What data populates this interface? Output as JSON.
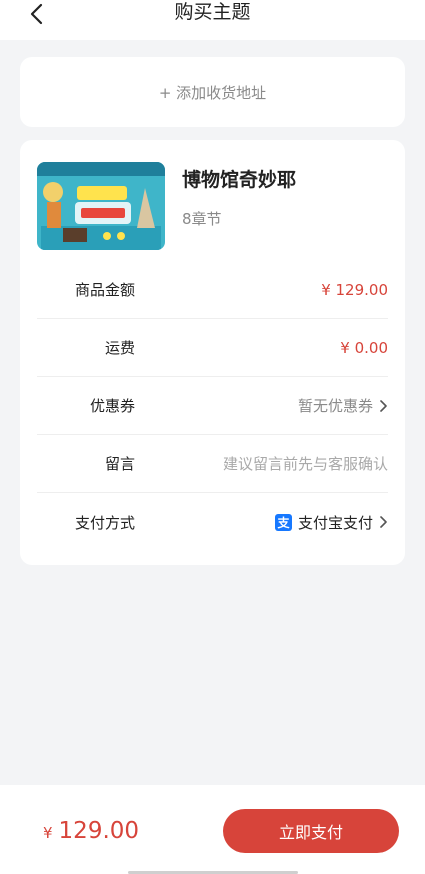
{
  "header": {
    "title": "购买主题",
    "back_icon": "chevron-left-icon"
  },
  "address": {
    "add_label": "+ 添加收货地址"
  },
  "product": {
    "name": "博物馆奇妙耶",
    "chapters": "8章节"
  },
  "order_rows": {
    "amount_label": "商品金额",
    "amount_value": "¥ 129.00",
    "shipping_label": "运费",
    "shipping_value": "¥ 0.00",
    "coupon_label": "优惠券",
    "coupon_value": "暂无优惠券",
    "message_label": "留言",
    "message_placeholder": "建议留言前先与客服确认",
    "payment_label": "支付方式",
    "payment_value": "支付宝支付",
    "payment_icon_glyph": "支"
  },
  "footer": {
    "total_symbol": "¥",
    "total_amount": "129.00",
    "pay_button": "立即支付"
  },
  "colors": {
    "accent": "#d7443a",
    "background": "#f3f4f6",
    "alipay_blue": "#1678ff"
  }
}
